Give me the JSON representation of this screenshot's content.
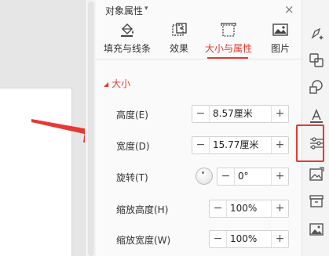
{
  "panel": {
    "title": "对象属性",
    "close_symbol": "×",
    "tabs": [
      {
        "label": "填充与线条",
        "icon": "fill-bucket-icon",
        "active": false
      },
      {
        "label": "效果",
        "icon": "effects-icon",
        "active": false
      },
      {
        "label": "大小与属性",
        "icon": "size-properties-icon",
        "active": true
      },
      {
        "label": "图片",
        "icon": "picture-icon",
        "active": false
      }
    ],
    "section": {
      "label": "大小"
    },
    "properties": [
      {
        "label": "高度(E)",
        "value": "8.57厘米"
      },
      {
        "label": "宽度(D)",
        "value": "15.77厘米"
      },
      {
        "label": "旋转(T)",
        "value": "0°"
      },
      {
        "label": "缩放高度(H)",
        "value": "100%"
      },
      {
        "label": "缩放宽度(W)",
        "value": "100%"
      }
    ],
    "spin_minus": "−",
    "spin_plus": "+"
  },
  "toolbar": {
    "icons": [
      "sparkle-style-icon",
      "shape-switch-icon",
      "shapes-icon",
      "text-format-icon",
      "properties-sliders-icon",
      "image-tool-icon",
      "archive-icon",
      "picture-icon"
    ],
    "highlighted": "properties-sliders-icon"
  },
  "colors": {
    "accent": "#e03b2f",
    "highlight": "#e53935"
  }
}
